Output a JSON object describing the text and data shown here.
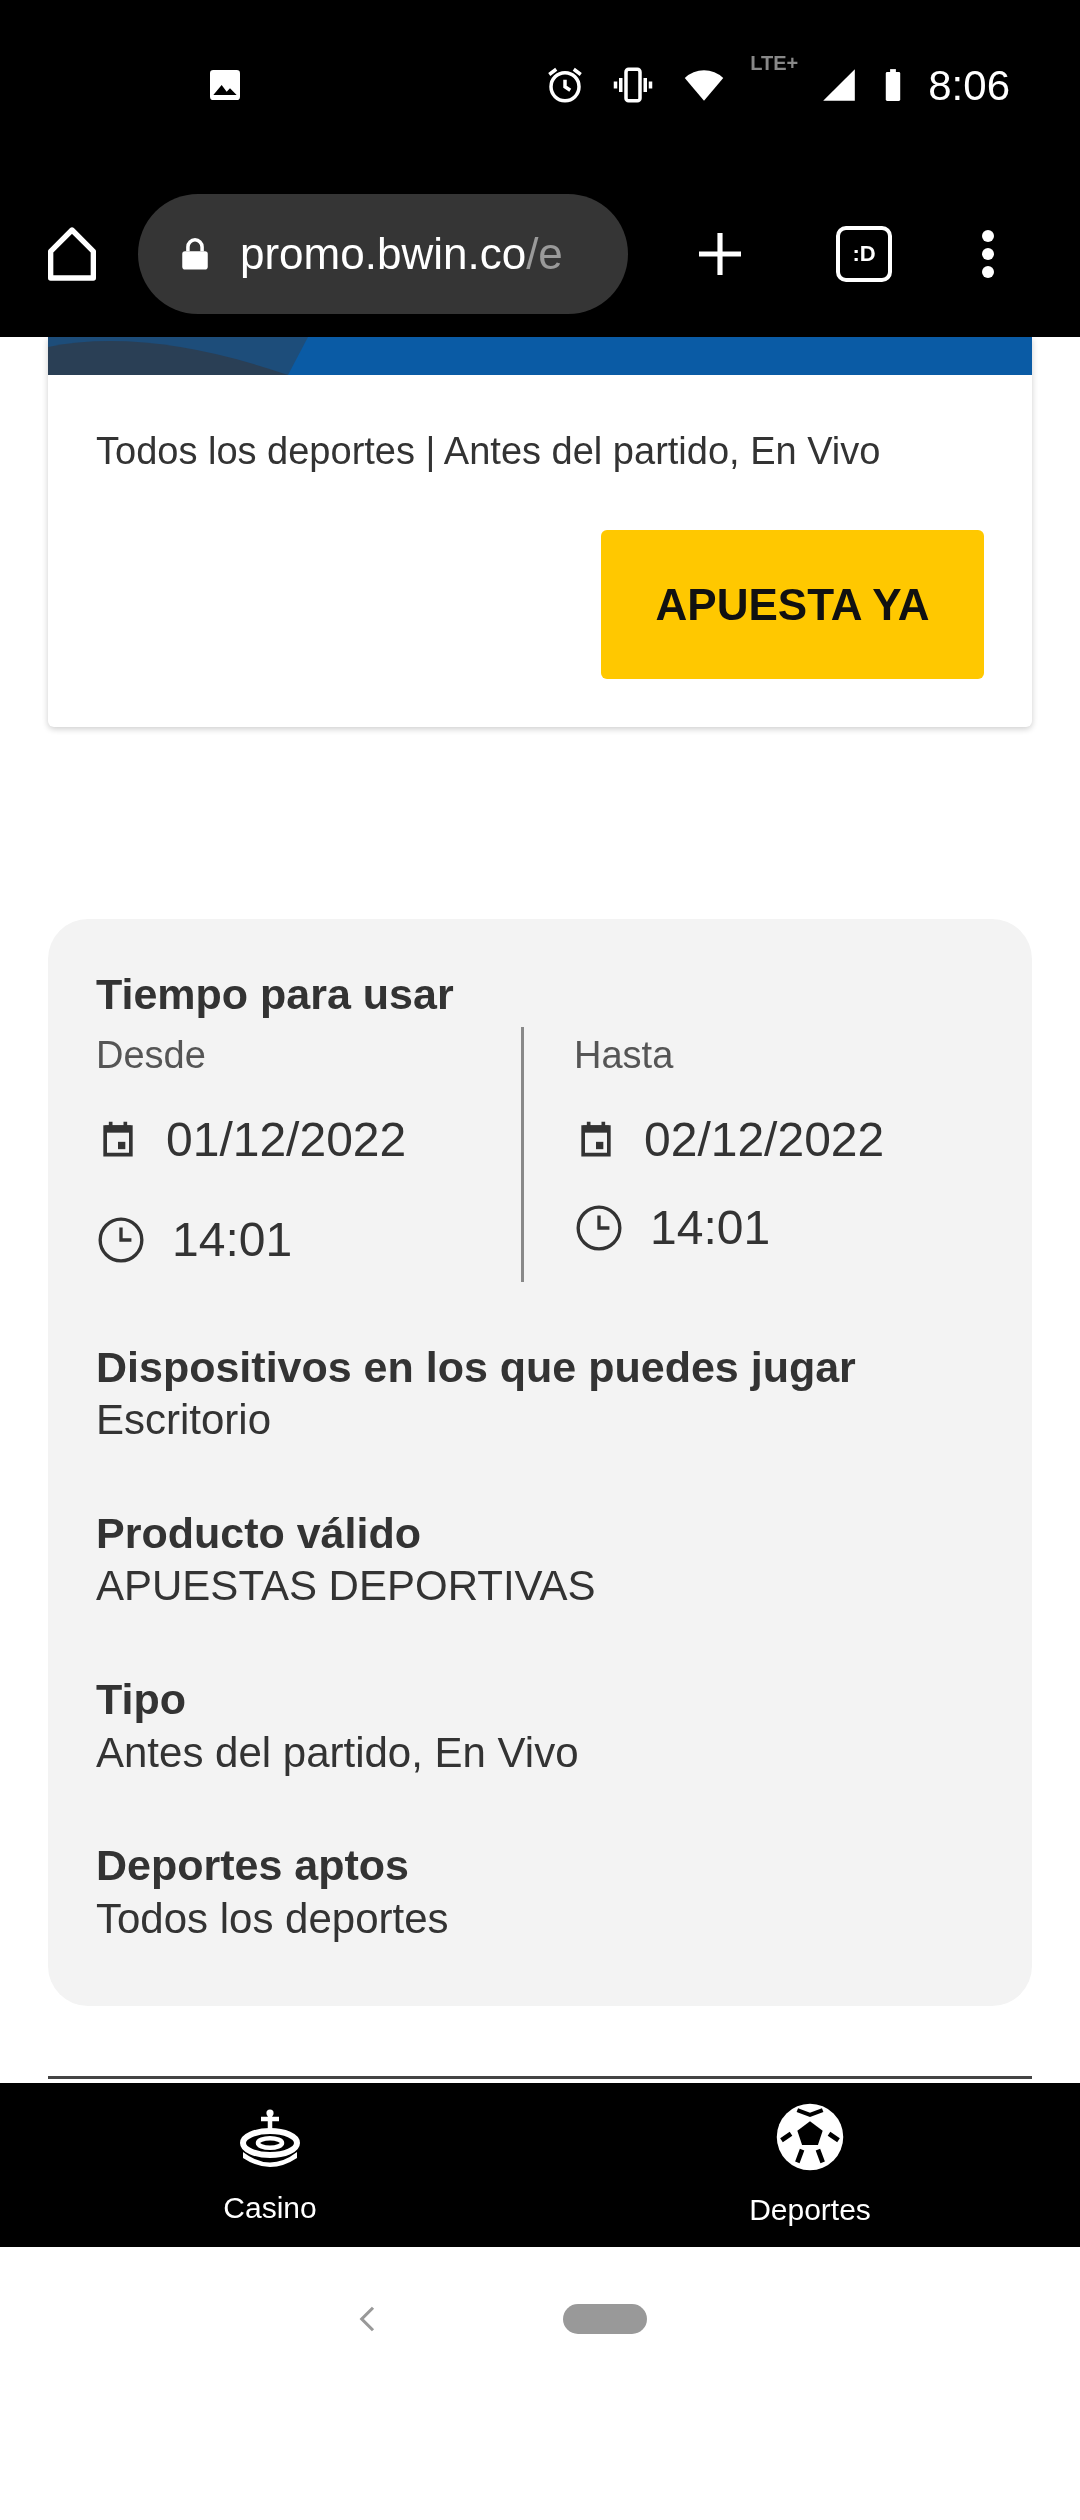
{
  "status_bar": {
    "time": "8:06",
    "network": "LTE+"
  },
  "browser": {
    "url_host": "promo.bwin.co",
    "url_path": "/e",
    "tab_switcher": ":D"
  },
  "promo_card": {
    "description": "Todos los deportes | Antes del partido, En Vivo",
    "button": "APUESTA YA"
  },
  "details": {
    "title": "Tiempo para usar",
    "periods": [
      {
        "label": "Desde",
        "date": "01/12/2022",
        "time": "14:01"
      },
      {
        "label": "Hasta",
        "date": "02/12/2022",
        "time": "14:01"
      }
    ],
    "sections": [
      {
        "title": "Dispositivos en los que puedes jugar",
        "value": "Escritorio"
      },
      {
        "title": "Producto válido",
        "value": "APUESTAS DEPORTIVAS"
      },
      {
        "title": "Tipo",
        "value": "Antes del partido, En Vivo"
      },
      {
        "title": "Deportes aptos",
        "value": "Todos los deportes"
      }
    ]
  },
  "bottom_nav": [
    {
      "label": "Casino",
      "kind": "casino"
    },
    {
      "label": "Deportes",
      "kind": "sports"
    }
  ]
}
